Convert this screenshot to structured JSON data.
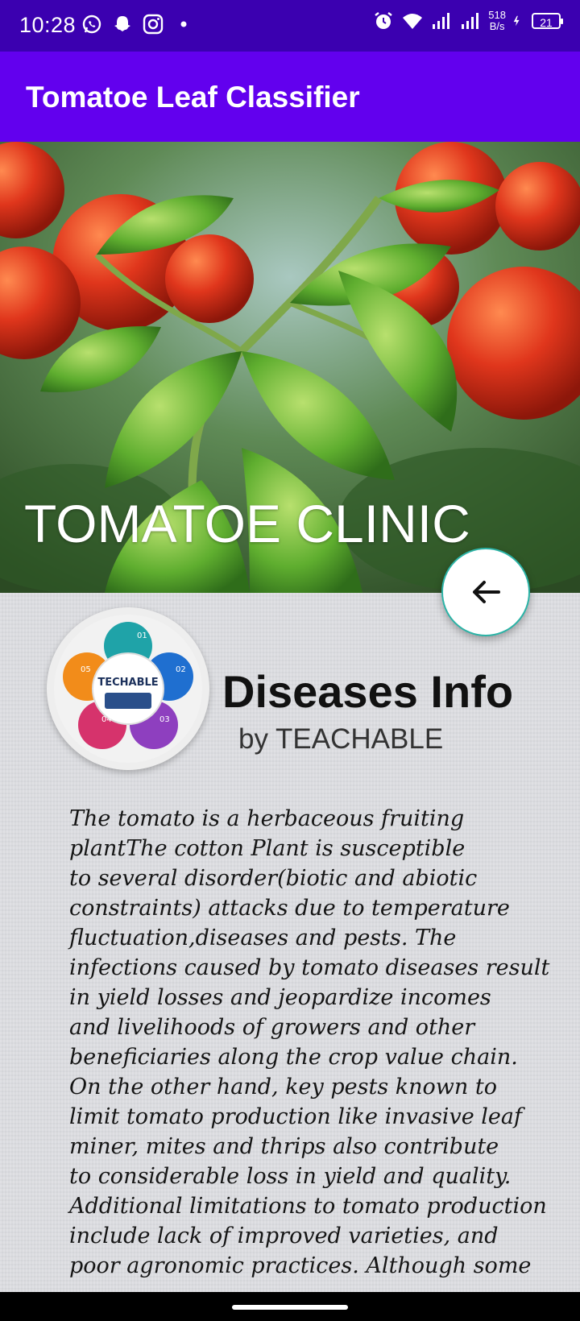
{
  "status_bar": {
    "time": "10:28",
    "left_icons": [
      "whatsapp-icon",
      "snapchat-icon",
      "instagram-icon",
      "dot-icon"
    ],
    "right_icons": [
      "alarm-icon",
      "wifi-icon",
      "signal-icon",
      "signal-icon"
    ],
    "net_speed_value": "518",
    "net_speed_unit": "B/s",
    "battery": "21"
  },
  "app_bar": {
    "title": "Tomatoe Leaf Classifier"
  },
  "hero": {
    "title": "TOMATOE CLINIC"
  },
  "fab": {
    "icon": "arrow-left-icon"
  },
  "logo": {
    "center": "TECHABLE",
    "segments": [
      "01",
      "02",
      "03",
      "04",
      "05"
    ]
  },
  "header": {
    "title": "Diseases Info",
    "subtitle": "by TEACHABLE"
  },
  "body_lines": [
    "The tomato is a herbaceous fruiting",
    "plantThe cotton Plant is susceptible",
    "to several disorder(biotic and abiotic",
    "constraints) attacks due to temperature",
    "fluctuation,diseases and pests. The",
    "infections caused by tomato diseases result",
    "in yield losses and jeopardize incomes",
    "and livelihoods of growers and other",
    "beneficiaries along the crop value chain.",
    "On the other hand, key pests known to",
    "limit tomato production like invasive leaf",
    "miner, mites and thrips also contribute",
    "to considerable loss in yield and quality.",
    "Additional limitations to tomato production",
    "include lack of improved varieties, and",
    "poor agronomic practices. Although some"
  ],
  "colors": {
    "status_bar": "#3b00b0",
    "app_bar": "#6200ee",
    "fab_border": "#2bb3a6"
  }
}
